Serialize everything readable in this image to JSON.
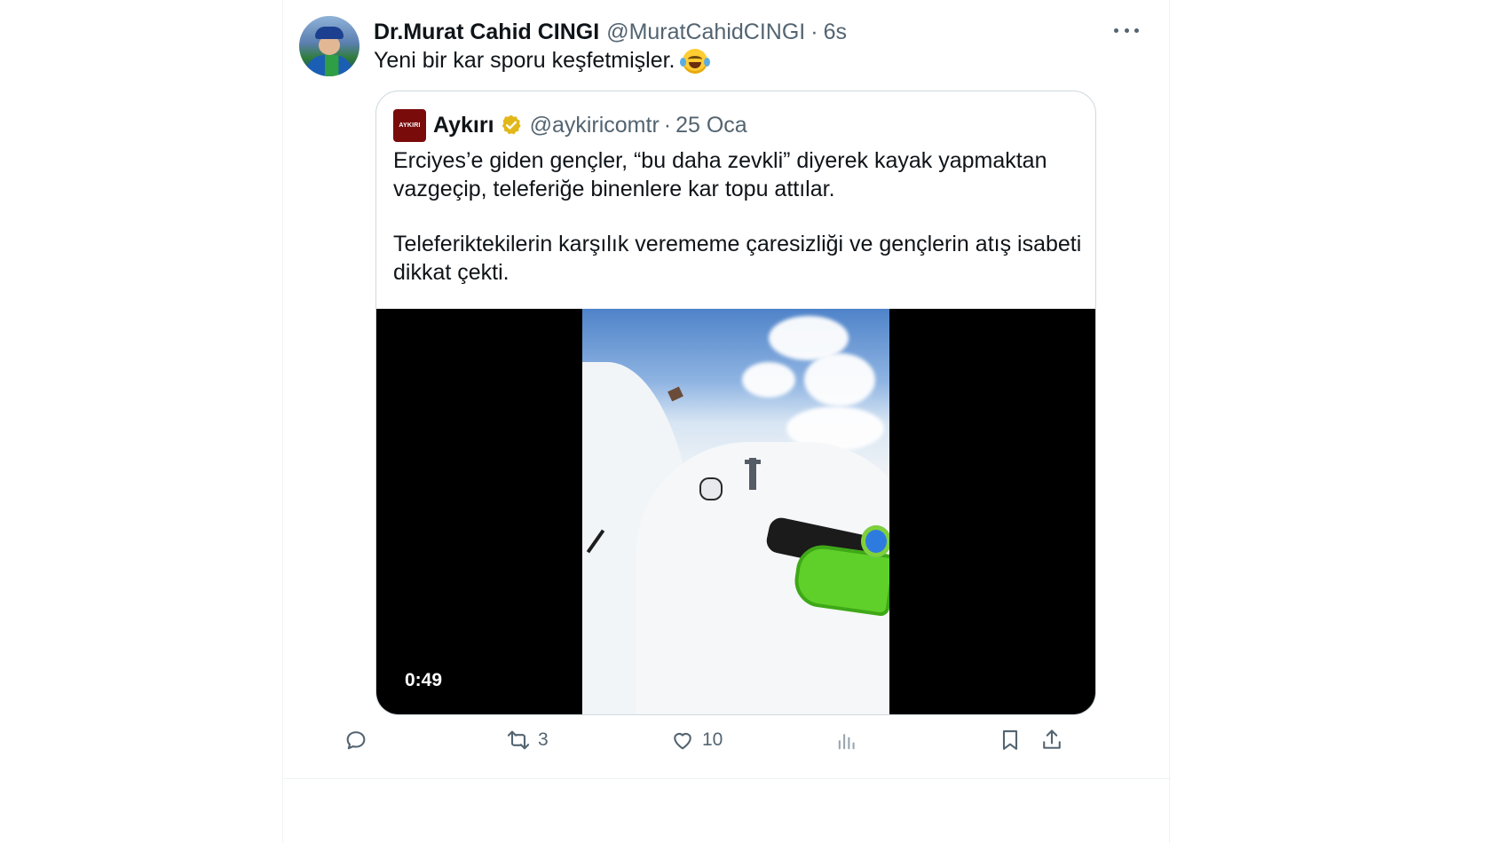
{
  "tweet": {
    "author_name": "Dr.Murat Cahid CINGI",
    "handle": "@MuratCahidCINGI",
    "separator": "·",
    "time": "6s",
    "text": "Yeni bir kar sporu keşfetmişler."
  },
  "quoted": {
    "logo_text": "AYKIRI",
    "author_name": "Aykırı",
    "handle": "@aykiricomtr",
    "separator": "·",
    "time": "25 Oca",
    "paragraph_1": "Erciyes’e giden gençler, “bu daha zevkli” diyerek kayak yapmaktan vazgeçip, teleferiğe binenlere kar topu attılar.",
    "paragraph_2": "Teleferiktekilerin karşılık verememe çaresizliği ve gençlerin atış isabeti dikkat çekti.",
    "video_duration": "0:49"
  },
  "actions": {
    "reply_count": "",
    "retweet_count": "3",
    "like_count": "10",
    "views_count": ""
  },
  "colors": {
    "text": "#0f1419",
    "secondary": "#536471",
    "border": "#cfd9de",
    "verified_gold": "#e2b719"
  }
}
